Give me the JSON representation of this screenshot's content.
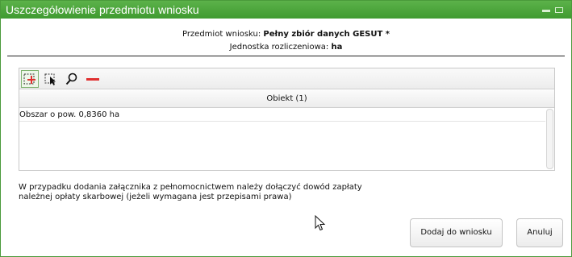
{
  "dialog": {
    "title": "Uszczegółowienie przedmiotu wniosku"
  },
  "subject": {
    "label": "Przedmiot wniosku:",
    "value": "Pełny zbiór danych GESUT *"
  },
  "unit": {
    "label": "Jednostka rozliczeniowa:",
    "value": "ha"
  },
  "toolbar": {
    "buttons": [
      {
        "icon": "add-selection-icon",
        "active": true
      },
      {
        "icon": "select-pointer-icon",
        "active": false
      },
      {
        "icon": "zoom-icon",
        "active": false
      },
      {
        "icon": "remove-icon",
        "active": false
      }
    ]
  },
  "grid": {
    "column_header": "Obiekt (1)",
    "rows": [
      "Obszar o pow. 0,8360 ha"
    ]
  },
  "note": {
    "line1": "W przypadku dodania załącznika z pełnomocnictwem należy dołączyć dowód zapłaty",
    "line2": "należnej opłaty skarbowej (jeżeli wymagana jest przepisami prawa)"
  },
  "buttons": {
    "add": "Dodaj do wniosku",
    "cancel": "Anuluj"
  },
  "colors": {
    "titlebar": "#4ea63d",
    "remove_icon": "#e03030"
  }
}
